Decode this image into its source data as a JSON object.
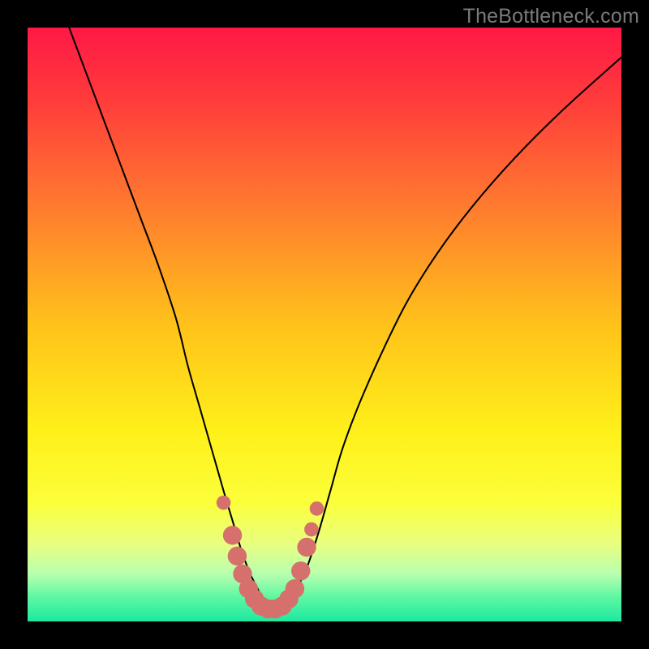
{
  "watermark": "TheBottleneck.com",
  "chart_data": {
    "type": "line",
    "title": "",
    "xlabel": "",
    "ylabel": "",
    "xlim": [
      0,
      100
    ],
    "ylim": [
      0,
      100
    ],
    "background_gradient": {
      "stops": [
        {
          "pos": 0.0,
          "color": "#ff1846"
        },
        {
          "pos": 0.12,
          "color": "#ff3b3b"
        },
        {
          "pos": 0.3,
          "color": "#ff7a2f"
        },
        {
          "pos": 0.5,
          "color": "#ffc21a"
        },
        {
          "pos": 0.68,
          "color": "#fff01a"
        },
        {
          "pos": 0.8,
          "color": "#fbff3a"
        },
        {
          "pos": 0.87,
          "color": "#e8ff80"
        },
        {
          "pos": 0.92,
          "color": "#b8ffb0"
        },
        {
          "pos": 0.96,
          "color": "#5cf7a2"
        },
        {
          "pos": 1.0,
          "color": "#1de9a0"
        }
      ]
    },
    "series": [
      {
        "name": "bottleneck-curve",
        "x": [
          7,
          10,
          13,
          16,
          19,
          22,
          25,
          27,
          29,
          31,
          33,
          34.5,
          36,
          37.5,
          39,
          40,
          41,
          42,
          43.5,
          45,
          47,
          49,
          51,
          53,
          56,
          60,
          64,
          69,
          75,
          82,
          90,
          100
        ],
        "y": [
          100,
          92,
          84,
          76,
          68,
          60,
          51,
          43,
          36,
          29,
          22,
          17,
          12,
          8,
          5,
          3,
          2,
          2,
          3,
          5,
          9,
          15,
          22,
          29,
          37,
          46,
          54,
          62,
          70,
          78,
          86,
          95
        ]
      }
    ],
    "markers": {
      "name": "highlight-dots",
      "color": "#d6706c",
      "points": [
        {
          "x": 33.0,
          "y": 20.0,
          "r": 1.2
        },
        {
          "x": 34.5,
          "y": 14.5,
          "r": 1.6
        },
        {
          "x": 35.3,
          "y": 11.0,
          "r": 1.6
        },
        {
          "x": 36.2,
          "y": 8.0,
          "r": 1.6
        },
        {
          "x": 37.2,
          "y": 5.5,
          "r": 1.6
        },
        {
          "x": 38.2,
          "y": 3.8,
          "r": 1.6
        },
        {
          "x": 39.3,
          "y": 2.6,
          "r": 1.6
        },
        {
          "x": 40.5,
          "y": 2.1,
          "r": 1.6
        },
        {
          "x": 41.7,
          "y": 2.1,
          "r": 1.6
        },
        {
          "x": 42.9,
          "y": 2.6,
          "r": 1.6
        },
        {
          "x": 44.0,
          "y": 3.8,
          "r": 1.6
        },
        {
          "x": 45.0,
          "y": 5.5,
          "r": 1.6
        },
        {
          "x": 46.0,
          "y": 8.5,
          "r": 1.6
        },
        {
          "x": 47.0,
          "y": 12.5,
          "r": 1.6
        },
        {
          "x": 47.8,
          "y": 15.5,
          "r": 1.2
        },
        {
          "x": 48.7,
          "y": 19.0,
          "r": 1.2
        }
      ]
    }
  }
}
